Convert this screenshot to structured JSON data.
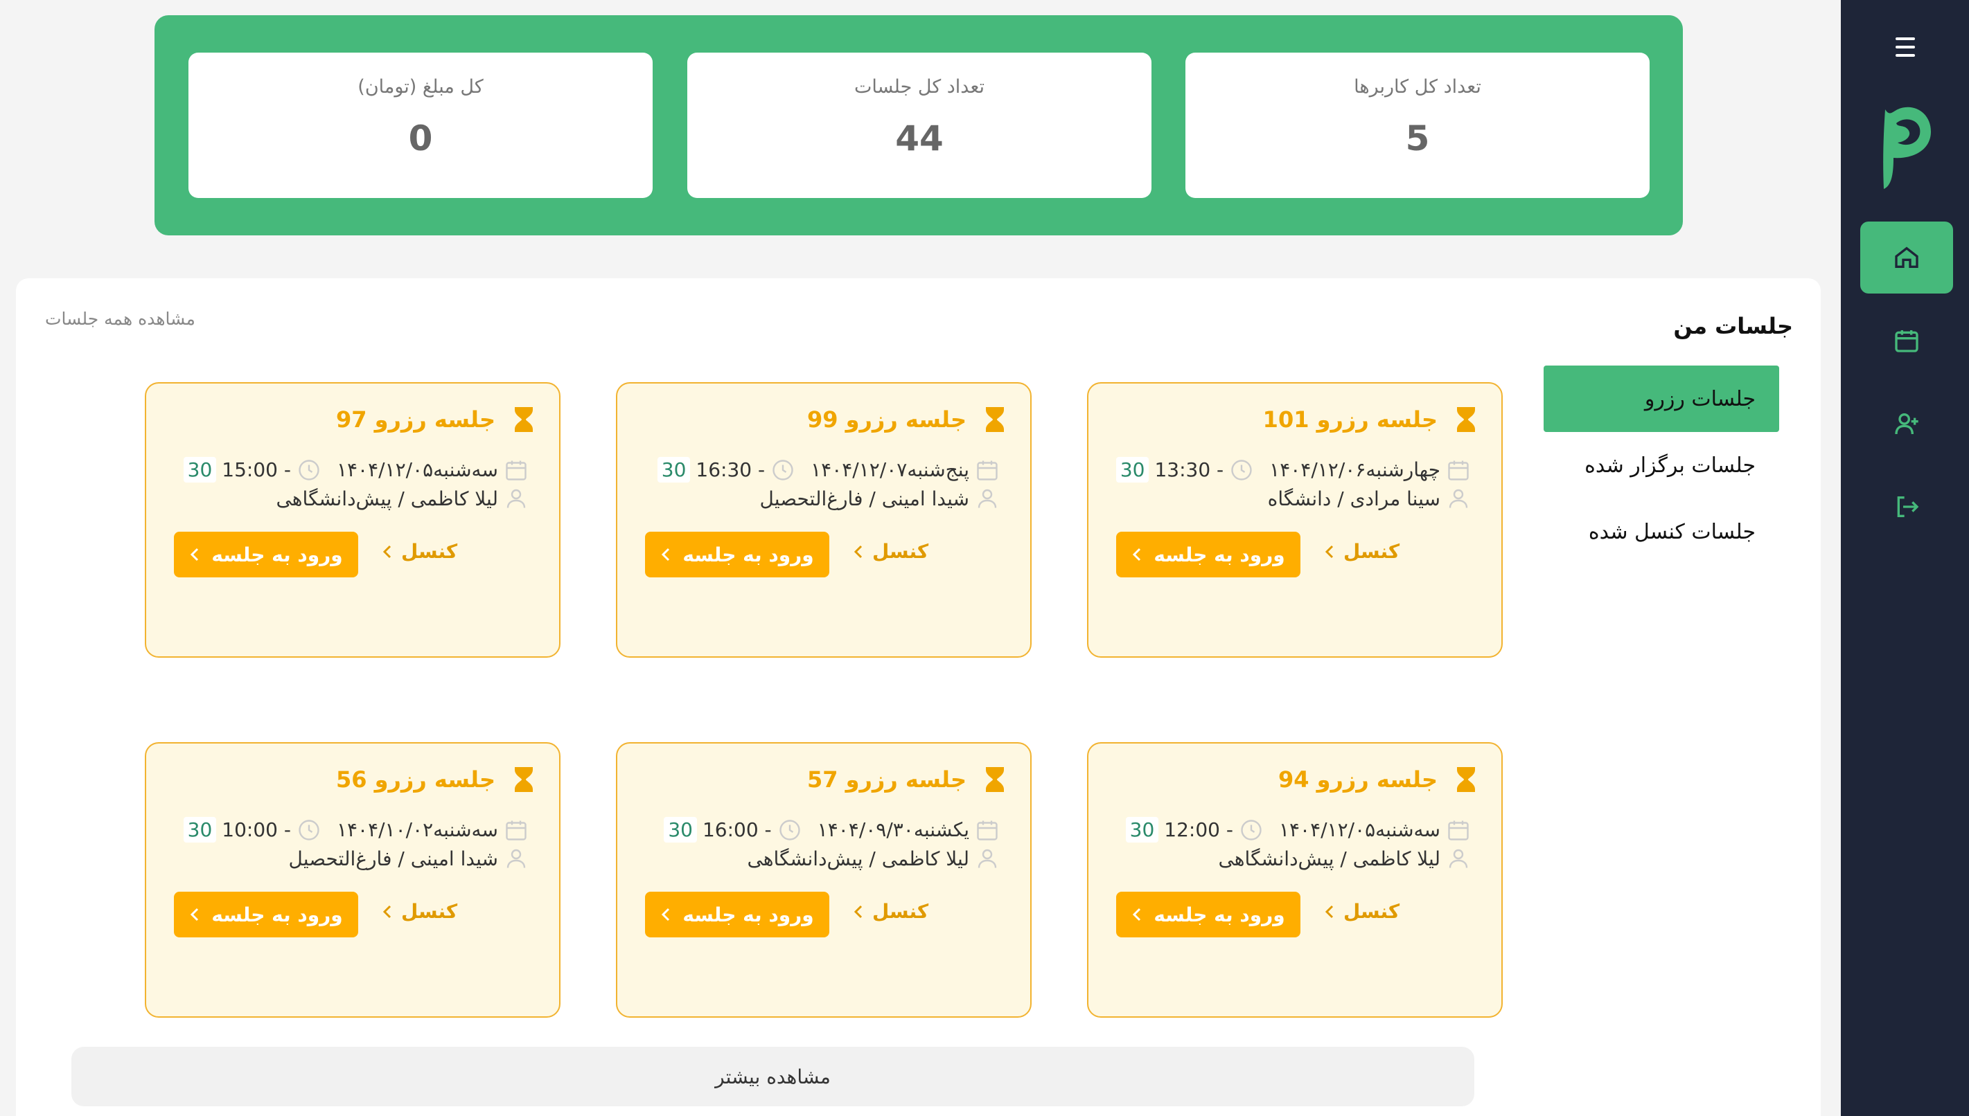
{
  "stats": [
    {
      "label": "تعداد کل کاربرها",
      "value": "5"
    },
    {
      "label": "تعداد کل جلسات",
      "value": "44"
    },
    {
      "label": "کل مبلغ (تومان)",
      "value": "0"
    }
  ],
  "sidebar": {
    "menu_icon": "hamburger-icon",
    "items": [
      {
        "name": "home",
        "icon": "home-icon"
      },
      {
        "name": "calendar",
        "icon": "calendar-icon"
      },
      {
        "name": "add-user",
        "icon": "user-plus-icon"
      },
      {
        "name": "logout",
        "icon": "logout-icon"
      }
    ]
  },
  "sessions": {
    "title": "جلسات من",
    "view_all": "مشاهده همه جلسات",
    "tabs": [
      "جلسات رزرو",
      "جلسات برگزار شده",
      "جلسات کنسل شده"
    ],
    "enter_label": "ورود به جلسه",
    "cancel_label": "کنسل",
    "more_label": "مشاهده بیشتر",
    "cards": [
      {
        "title": "جلسه رزرو 101",
        "date": "چهارشنبه۱۴۰۴/۱۲/۰۶",
        "time": "13:30 -",
        "duration": "30",
        "person": "سینا مرادی / دانشگاه"
      },
      {
        "title": "جلسه رزرو 99",
        "date": "پنج‌شنبه۱۴۰۴/۱۲/۰۷",
        "time": "16:30 -",
        "duration": "30",
        "person": "شیدا امینی / فارغ‌التحصیل"
      },
      {
        "title": "جلسه رزرو 97",
        "date": "سه‌شنبه۱۴۰۴/۱۲/۰۵",
        "time": "15:00 -",
        "duration": "30",
        "person": "لیلا کاظمی / پیش‌دانشگاهی"
      },
      {
        "title": "جلسه رزرو 94",
        "date": "سه‌شنبه۱۴۰۴/۱۲/۰۵",
        "time": "12:00 -",
        "duration": "30",
        "person": "لیلا کاظمی / پیش‌دانشگاهی"
      },
      {
        "title": "جلسه رزرو 57",
        "date": "یکشنبه۱۴۰۴/۰۹/۳۰",
        "time": "16:00 -",
        "duration": "30",
        "person": "لیلا کاظمی / پیش‌دانشگاهی"
      },
      {
        "title": "جلسه رزرو 56",
        "date": "سه‌شنبه۱۴۰۴/۱۰/۰۲",
        "time": "10:00 -",
        "duration": "30",
        "person": "شیدا امینی / فارغ‌التحصیل"
      }
    ]
  },
  "colors": {
    "accent": "#46b97b",
    "sidebar": "#1e2538",
    "amber": "#ffae00",
    "card_bg": "#fef8e2"
  }
}
